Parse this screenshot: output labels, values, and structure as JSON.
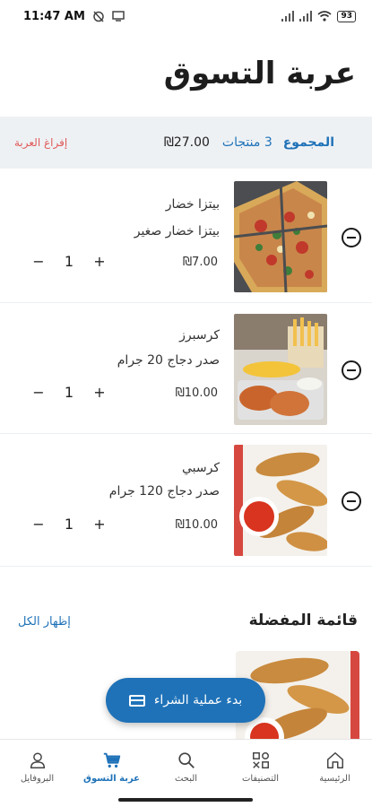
{
  "status_bar": {
    "time": "11:47 AM",
    "battery": "93"
  },
  "page": {
    "title": "عربة التسوق"
  },
  "summary": {
    "label": "المجموع",
    "count": "3 منتجات",
    "total": "₪27.00",
    "clear_label": "إفراغ العربة"
  },
  "cart": {
    "items": [
      {
        "name": "بيتزا خضار",
        "description": "بيتزا خضار صغير",
        "price": "₪7.00",
        "quantity": "1",
        "minus": "−",
        "plus": "+",
        "image": "pizza"
      },
      {
        "name": "كرسبرز",
        "description": "صدر دجاج 20 جرام",
        "price": "₪10.00",
        "quantity": "1",
        "minus": "−",
        "plus": "+",
        "image": "crispers"
      },
      {
        "name": "كرسبي",
        "description": "صدر دجاج 120 جرام",
        "price": "₪10.00",
        "quantity": "1",
        "minus": "−",
        "plus": "+",
        "image": "crispy"
      }
    ]
  },
  "favorites": {
    "title": "قائمة المفضلة",
    "show_all": "إظهار الكل"
  },
  "checkout": {
    "label": "بدء عملية الشراء",
    "icon": "credit-card-icon"
  },
  "bottom_nav": {
    "items": [
      {
        "label": "الرئيسية",
        "icon": "home-icon"
      },
      {
        "label": "التصنيفات",
        "icon": "categories-icon"
      },
      {
        "label": "البحث",
        "icon": "search-icon"
      },
      {
        "label": "عربة التسوق",
        "icon": "cart-icon",
        "active": true
      },
      {
        "label": "البروفايل",
        "icon": "profile-icon"
      }
    ]
  },
  "colors": {
    "accent": "#1f72b8",
    "danger": "#e05a5a",
    "summary_bg": "#eef1f4"
  }
}
